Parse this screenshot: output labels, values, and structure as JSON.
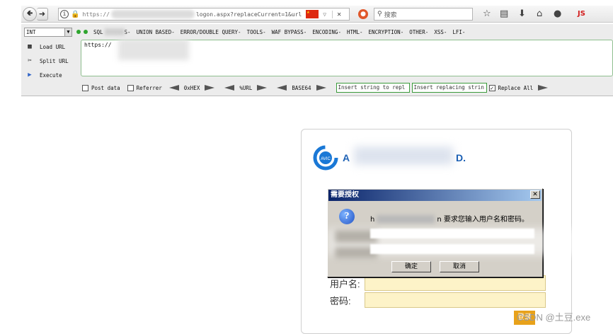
{
  "browser": {
    "url_prefix": "https://",
    "url_suffix": "logon.aspx?replaceCurrent=1&url",
    "search_placeholder": "搜索",
    "toolbar_icons": [
      "star-icon",
      "reading-list-icon",
      "download-icon",
      "home-icon",
      "globe-icon",
      "js-icon"
    ],
    "js_label": "JS"
  },
  "hackbar": {
    "int_value": "INT",
    "menus": [
      "SQL",
      "S-",
      "UNION BASED-",
      "ERROR/DOUBLE QUERY-",
      "TOOLS-",
      "WAF BYPASS-",
      "ENCODING-",
      "HTML-",
      "ENCRYPTION-",
      "OTHER-",
      "XSS-",
      "LFI-"
    ],
    "side": {
      "load_url": "Load URL",
      "split_url": "Split URL",
      "execute": "Execute"
    },
    "url_value": "https://",
    "post_data": "Post data",
    "referrer": "Referrer",
    "hex": "0xHEX",
    "url_enc": "%URL",
    "base64": "BASE64",
    "insert_placeholder": "Insert string to repl",
    "replacing_placeholder": "Insert replacing strin",
    "replace_all": "Replace All",
    "replace_all_checked": true
  },
  "login": {
    "logo_prefix": "A",
    "logo_suffix": "D.",
    "user_label": "用户名:",
    "pass_label": "密码:",
    "button": "登录"
  },
  "auth_dialog": {
    "title": "需要授权",
    "msg_prefix": "h",
    "msg_mid": "n",
    "msg_suffix": "要求您输入用户名和密码。",
    "ok": "确定",
    "cancel": "取消"
  },
  "watermark": "CSDN @土豆.exe"
}
